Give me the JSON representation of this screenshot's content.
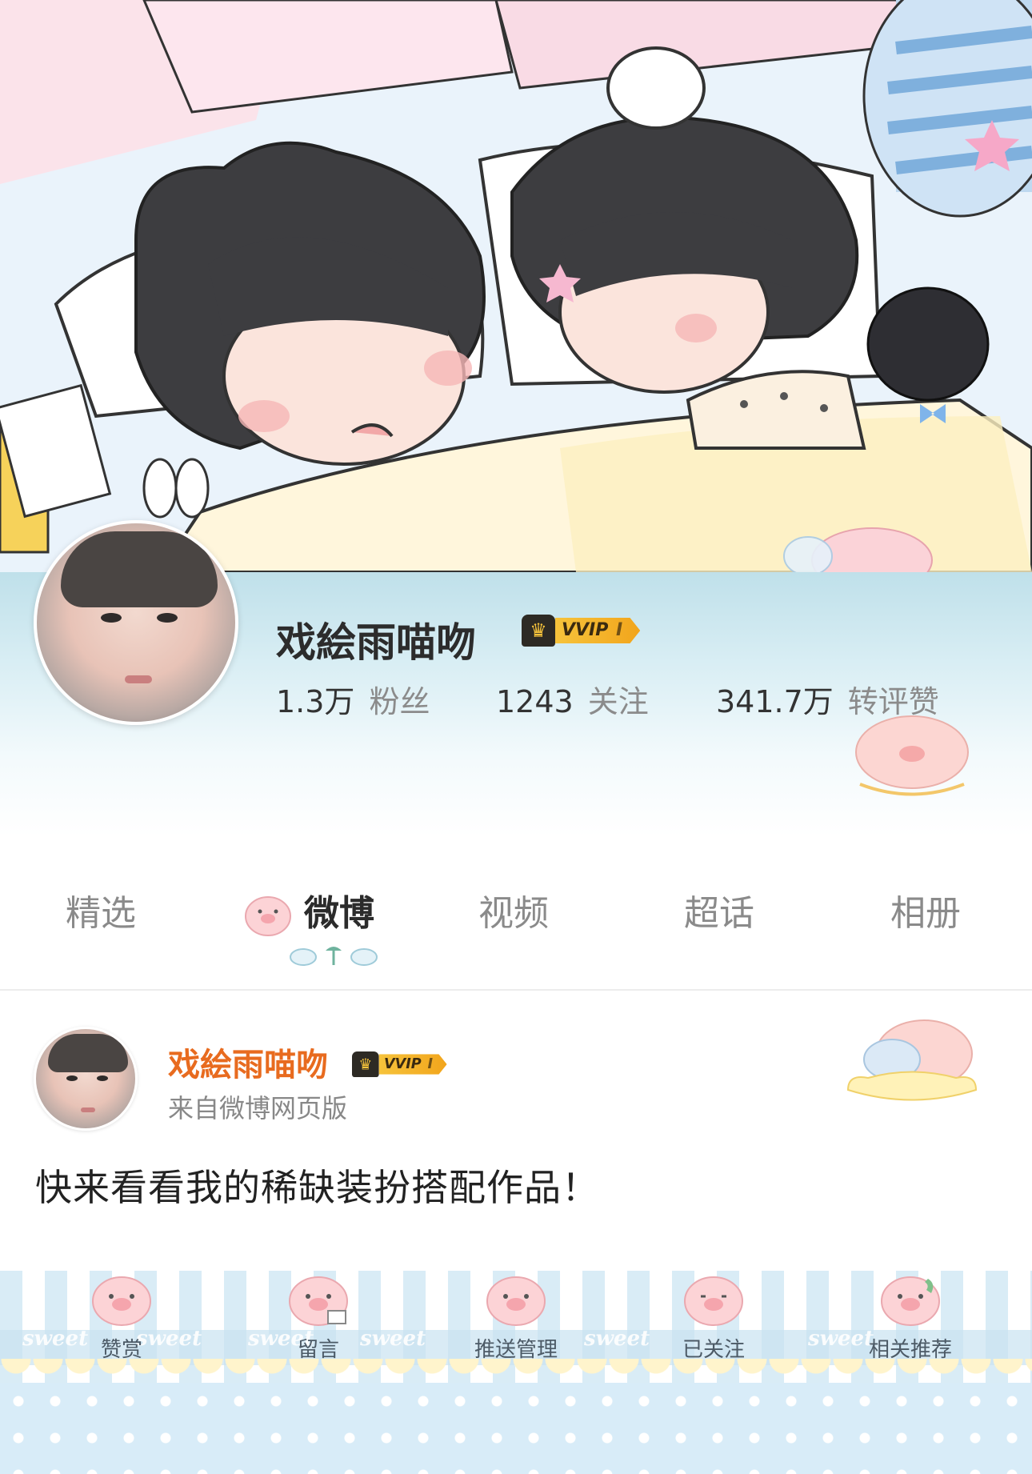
{
  "profile": {
    "name": "戏絵雨喵吻",
    "vip_label": "VVIP",
    "vip_level": "I",
    "stats": [
      {
        "value": "1.3万",
        "label": "粉丝"
      },
      {
        "value": "1243",
        "label": "关注"
      },
      {
        "value": "341.7万",
        "label": "转评赞"
      }
    ]
  },
  "tabs": [
    {
      "label": "精选",
      "active": false
    },
    {
      "label": "微博",
      "active": true
    },
    {
      "label": "视频",
      "active": false
    },
    {
      "label": "超话",
      "active": false
    },
    {
      "label": "相册",
      "active": false
    }
  ],
  "post": {
    "author": "戏絵雨喵吻",
    "vip_label": "VVIP",
    "vip_level": "I",
    "source": "来自微博网页版",
    "text": "快来看看我的稀缺装扮搭配作品！"
  },
  "actions": [
    {
      "label": "赞赏",
      "icon": "pig-icon"
    },
    {
      "label": "留言",
      "icon": "pig-message-icon"
    },
    {
      "label": "推送管理",
      "icon": "pig-icon"
    },
    {
      "label": "已关注",
      "icon": "pig-icon"
    },
    {
      "label": "相关推荐",
      "icon": "pig-phone-icon"
    }
  ],
  "decor_text": "sweet",
  "colors": {
    "accent_orange": "#e86b1f",
    "vip_gold": "#f6c33b",
    "band_blue": "#bfe0ea"
  }
}
